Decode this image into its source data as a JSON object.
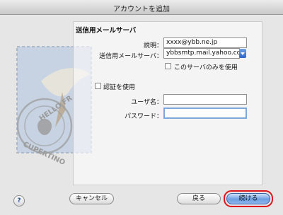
{
  "window": {
    "title": "アカウントを追加"
  },
  "section": {
    "title": "送信用メールサーバ"
  },
  "fields": {
    "description": {
      "label": "説明：",
      "value": "xxxx@ybb.ne.jp"
    },
    "smtp_server": {
      "label": "送信用メールサーバ：",
      "value": "ybbsmtp.mail.yahoo.co.j"
    },
    "only_this_server": {
      "label": "このサーバのみを使用",
      "checked": false
    },
    "use_auth": {
      "label": "認証を使用",
      "checked": false
    },
    "username": {
      "label": "ユーザ名：",
      "value": ""
    },
    "password": {
      "label": "パスワード：",
      "value": ""
    }
  },
  "buttons": {
    "help": "?",
    "cancel": "キャンセル",
    "back": "戻る",
    "continue": "続ける"
  },
  "stamp": {
    "text_top": "HELLO FR",
    "text_bottom": "CUPERTINO"
  },
  "colors": {
    "highlight": "#e0161b",
    "primary": "#6c9ee0",
    "focus_ring": "#7ba7d9"
  }
}
